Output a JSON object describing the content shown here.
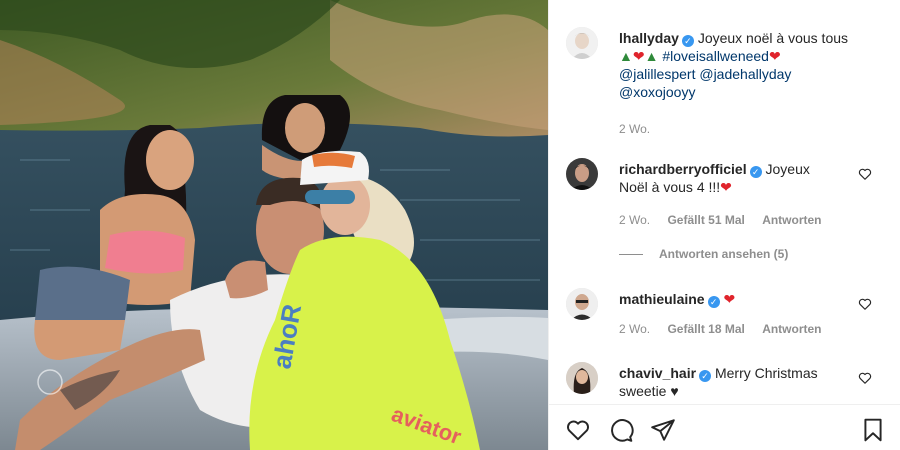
{
  "post": {
    "author": "lhallyday",
    "caption_text": "Joyeux noël à vous tous",
    "hashtag": "#loveisallweneed",
    "mentions": [
      "@jalillespert",
      "@jadehallyday",
      "@xoxojooyy"
    ],
    "time": "2 Wo."
  },
  "comments": [
    {
      "username": "richardberryofficiel",
      "text_line1": "Joyeux",
      "text_line2": "Noël à vous 4 !!!",
      "time": "2 Wo.",
      "likes": "Gefällt 51 Mal",
      "reply_label": "Antworten",
      "view_replies": "Antworten ansehen (5)"
    },
    {
      "username": "mathieulaine",
      "time": "2 Wo.",
      "likes": "Gefällt 18 Mal",
      "reply_label": "Antworten"
    },
    {
      "username": "chaviv_hair",
      "text_line1": "Merry Christmas",
      "text_line2": "sweetie ♥"
    }
  ],
  "icons": {
    "verified": "verified-badge-icon",
    "like": "heart-icon",
    "comment": "comment-icon",
    "share": "share-icon",
    "save": "bookmark-icon"
  },
  "colors": {
    "verified": "#3897f0",
    "heart": "#e0242c",
    "link": "#00376b",
    "meta": "#8e8e8e"
  }
}
